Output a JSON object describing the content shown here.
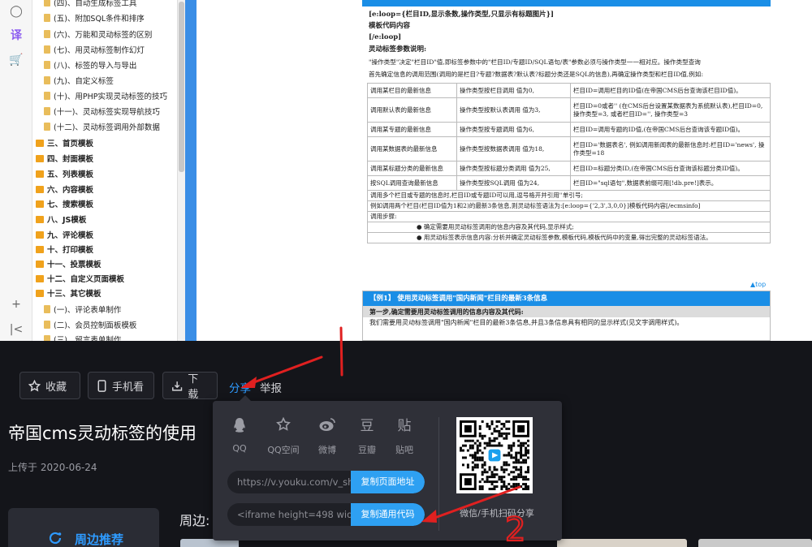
{
  "doc_tree": [
    {
      "label": "(四)、自动生成标签工具",
      "level": 2
    },
    {
      "label": "(五)、附加SQL条件和排序",
      "level": 2
    },
    {
      "label": "(六)、万能和灵动标签的区别",
      "level": 2
    },
    {
      "label": "(七)、用灵动标签制作幻灯",
      "level": 2
    },
    {
      "label": "(八)、标签的导入与导出",
      "level": 2
    },
    {
      "label": "(九)、自定义标签",
      "level": 2
    },
    {
      "label": "(十)、用PHP实现灵动标签的技巧",
      "level": 2
    },
    {
      "label": "(十一)、灵动标签实现导航技巧",
      "level": 2
    },
    {
      "label": "(十二)、灵动标签调用外部数据",
      "level": 2
    },
    {
      "label": "三、首页模板",
      "level": 1
    },
    {
      "label": "四、封面模板",
      "level": 1
    },
    {
      "label": "五、列表模板",
      "level": 1
    },
    {
      "label": "六、内容模板",
      "level": 1
    },
    {
      "label": "七、搜索模板",
      "level": 1
    },
    {
      "label": "八、JS模板",
      "level": 1
    },
    {
      "label": "九、评论模板",
      "level": 1
    },
    {
      "label": "十、打印模板",
      "level": 1
    },
    {
      "label": "十一、投票模板",
      "level": 1
    },
    {
      "label": "十二、自定义页面模板",
      "level": 1
    },
    {
      "label": "十三、其它模板",
      "level": 1
    },
    {
      "label": "(一)、评论表单制作",
      "level": 2
    },
    {
      "label": "(二)、会员控制面板模板",
      "level": 2
    },
    {
      "label": "(三)、留言表单制作",
      "level": 2
    }
  ],
  "doc": {
    "lines": [
      "[e:loop={栏目ID,显示条数,操作类型,只显示有标题图片}]",
      "模板代码内容",
      "[/e:loop]",
      "灵动标签参数说明:",
      "\"操作类型\"决定\"栏目ID\"值,即标签参数中的\"栏目ID/专题ID/SQL语句/表\"参数必须与操作类型一一相对应。操作类型查询",
      "首先确定信息的调用范围(调用的是栏目?专题?数据表?默认表?标题分类还是SQL的信息),再确定操作类型和栏目ID值,例如:"
    ],
    "table": [
      [
        "调用某栏目的最新信息",
        "操作类型按栏目调用 值为0,",
        "栏目ID=调用栏目的ID值(在帝国CMS后台查询该栏目ID值)。"
      ],
      [
        "调用默认表的最新信息",
        "操作类型按默认表调用 值为3,",
        "栏目ID=0或者'' (在CMS后台设置某数据表为系统默认表),栏目ID=0, 操作类型=3, 或者栏目ID='', 操作类型=3"
      ],
      [
        "调用某专题的最新信息",
        "操作类型按专题调用 值为6,",
        "栏目ID=调用专题的ID值,(在帝国CMS后台查询该专题ID值)。"
      ],
      [
        "调用某数据表的最新信息",
        "操作类型按数据表调用 值为18,",
        "栏目ID='数据表名', 例如调用新闻表的最新信息时:栏目ID='news', 操作类型=18"
      ],
      [
        "调用某标题分类的最新信息",
        "操作类型按标题分类调用 值为25,",
        "栏目ID=标题分类ID,(在帝国CMS后台查询该标题分类ID值)。"
      ],
      [
        "按SQL调用查询最新信息",
        "操作类型按SQL调用 值为24,",
        "栏目ID=\"sql语句\",数据表前缀可用[!db.pre!]表示。"
      ]
    ],
    "notes": [
      "调用多个栏目或专题的信息时,栏目ID或专题ID可以用,逗号格开并引用''单引号;",
      "例如调用两个栏目(栏目ID值为1和2)的最新3条信息,则灵动标签语法为:[e:loop={'2,3',3,0,0}]模板代码内容[/ecmsinfo]",
      "调用步骤:",
      "● 确定需要用灵动标签调用的信息内容及其代码,显示样式;",
      "● 用灵动标签表示信息内容:分析并确定灵动标签参数,模板代码,模板代码中的变量,得出完整的灵动标签语法。"
    ],
    "to_top": "▲top",
    "example_title": "【例1】 使用灵动标签调用\"国内新闻\"栏目的最新3条信息",
    "example_step": "第一步,确定需要用灵动标签调用的信息内容及其代码:",
    "example_text": "我们需要用灵动标签调用\"国内新闻\"栏目的最新3条信息,并且3条信息具有相同的显示样式(见文字调用样式)。"
  },
  "taskbar": {
    "icons": [
      "windows-start-icon",
      "search-icon",
      "cortana-icon",
      "task-view-icon",
      "file-explorer-icon",
      "mail-icon",
      "baidu-netdisk-icon",
      "edge-icon",
      "green-app-icon",
      "feishu-icon",
      "word-icon",
      "red-app-icon",
      "obs-icon"
    ]
  },
  "actions": {
    "favorite": "收藏",
    "mobile": "手机看",
    "download": "下载",
    "share": "分享",
    "report": "举报"
  },
  "video": {
    "title": "帝国cms灵动标签的使用",
    "uploaded": "上传于 2020-06-24"
  },
  "share_popup": {
    "platforms": [
      {
        "label": "QQ",
        "icon": "qq-icon"
      },
      {
        "label": "QQ空间",
        "icon": "qzone-star-icon"
      },
      {
        "label": "微博",
        "icon": "weibo-icon"
      },
      {
        "label": "豆瓣",
        "icon": "douban-icon",
        "glyph": "豆"
      },
      {
        "label": "贴吧",
        "icon": "tieba-icon",
        "glyph": "贴"
      }
    ],
    "page_url": "https://v.youku.com/v_sh",
    "copy_page_label": "复制页面地址",
    "embed_code": "<iframe height=498 widt",
    "copy_code_label": "复制通用代码",
    "qr_caption": "微信/手机扫码分享"
  },
  "nearby": {
    "card_label": "周边推荐",
    "heading": "周边:"
  },
  "annotation": {
    "mark": "2"
  },
  "colors": {
    "accent": "#2e9bff",
    "page_bg": "#14151a",
    "popup_bg": "#2f3038",
    "copy_btn": "#2ea0f2",
    "annotation": "#e02020",
    "doc_header": "#1a8ee6"
  }
}
